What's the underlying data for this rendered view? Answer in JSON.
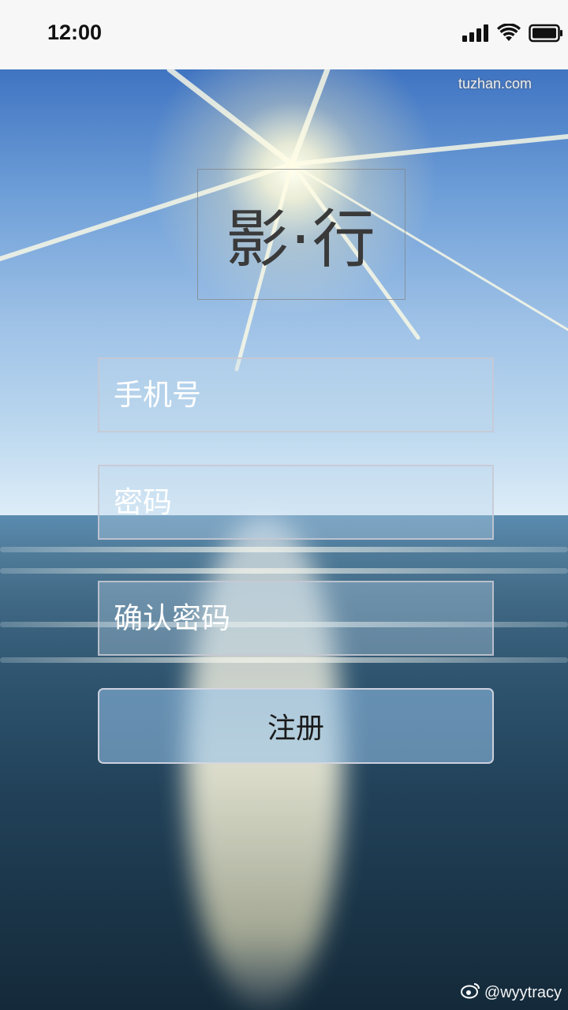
{
  "status_bar": {
    "time": "12:00"
  },
  "app": {
    "logo_text": "影·行"
  },
  "form": {
    "phone_placeholder": "手机号",
    "password_placeholder": "密码",
    "confirm_password_placeholder": "确认密码",
    "register_label": "注册"
  },
  "watermarks": {
    "top": "tuzhan.com",
    "bottom": "@wyytracy"
  },
  "icons": {
    "signal": "cellular-signal-icon",
    "wifi": "wifi-icon",
    "battery": "battery-icon",
    "weibo": "weibo-icon"
  },
  "colors": {
    "button_bg": "#96c3eb",
    "logo_text": "#3a3a3a",
    "status_bar_bg": "#f7f7f7"
  }
}
